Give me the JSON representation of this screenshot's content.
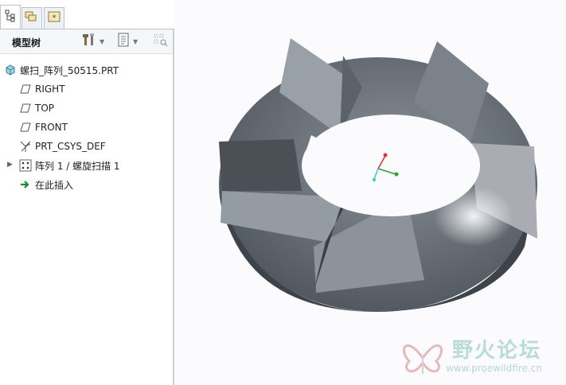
{
  "tabs": [
    {
      "icon": "model-tree-icon",
      "active": true
    },
    {
      "icon": "folder-browser-icon",
      "active": false
    },
    {
      "icon": "favorites-icon",
      "active": false
    }
  ],
  "panel": {
    "title": "模型树",
    "tools": [
      "settings-tools-icon",
      "show-list-icon",
      "filter-icon"
    ]
  },
  "tree": {
    "root": "螺扫_阵列_50515.PRT",
    "items": [
      {
        "label": "RIGHT",
        "icon": "datum-plane-icon"
      },
      {
        "label": "TOP",
        "icon": "datum-plane-icon"
      },
      {
        "label": "FRONT",
        "icon": "datum-plane-icon"
      },
      {
        "label": "PRT_CSYS_DEF",
        "icon": "coordinate-system-icon"
      },
      {
        "label": "阵列 1 / 螺旋扫描 1",
        "icon": "pattern-icon"
      },
      {
        "label": "在此插入",
        "icon": "insert-here-arrow-icon"
      }
    ]
  },
  "watermark": {
    "text": "野火论坛",
    "url": "www.proewildfire.cn"
  },
  "colors": {
    "part_dark": "#3d4249",
    "part_mid": "#6e747c",
    "part_light": "#a9adb3",
    "tab_border": "#b9c3cf",
    "watermark": "#b8dcd6"
  }
}
